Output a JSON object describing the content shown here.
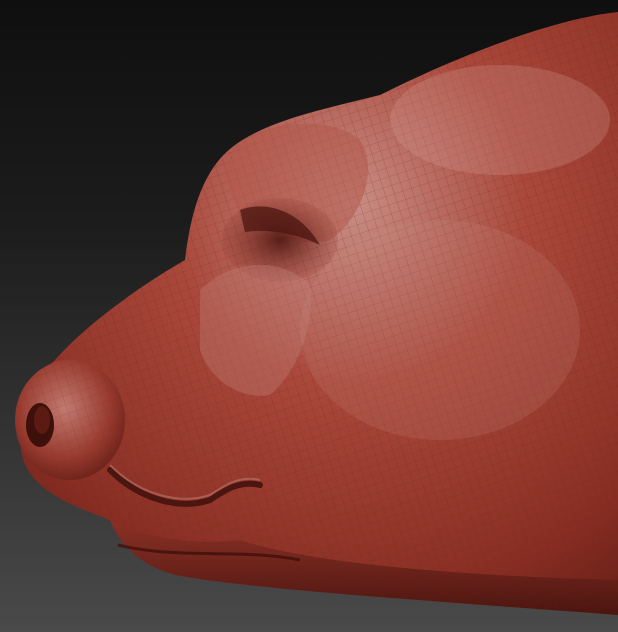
{
  "scene": {
    "subject": "3d-sculpt-animal-snout",
    "colors": {
      "background_top": "#0f0f0f",
      "background_bottom": "#4a4a4a",
      "clay_base": "#9a3a2e",
      "clay_highlight": "#c98f86",
      "clay_shadow": "#4b1510",
      "wireframe": "#6e2219"
    }
  }
}
